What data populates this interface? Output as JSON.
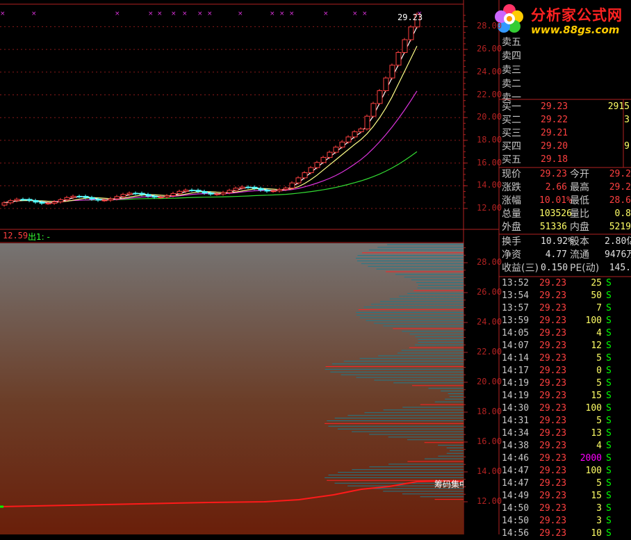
{
  "watermark": {
    "brand": "分析家公式网",
    "url": "www.88gs.com"
  },
  "main_chart": {
    "peak_label": "29.23",
    "y_axis_labels": [
      "28.00",
      "26.00",
      "24.00",
      "22.00",
      "20.00",
      "18.00",
      "16.00",
      "14.00",
      "12.00"
    ]
  },
  "sub_chart": {
    "header_value": "12.59",
    "header_label": "出1: -",
    "annotation": "筹码集中",
    "y_axis_labels": [
      "28.00",
      "26.00",
      "24.00",
      "22.00",
      "20.00",
      "18.00",
      "16.00",
      "14.00",
      "12.00"
    ]
  },
  "quote_panel": {
    "sell_labels": [
      "卖五",
      "卖四",
      "卖三",
      "卖二",
      "卖一"
    ],
    "buy": [
      {
        "label": "买一",
        "price": "29.23",
        "vol": "2915"
      },
      {
        "label": "买二",
        "price": "29.22",
        "vol": "3"
      },
      {
        "label": "买三",
        "price": "29.21",
        "vol": ""
      },
      {
        "label": "买四",
        "price": "29.20",
        "vol": "9"
      },
      {
        "label": "买五",
        "price": "29.18",
        "vol": ""
      }
    ],
    "stats": [
      {
        "l1": "现价",
        "v1": "29.23",
        "l2": "今开",
        "v2": "29.2"
      },
      {
        "l1": "涨跌",
        "v1": "2.66",
        "l2": "最高",
        "v2": "29.2"
      },
      {
        "l1": "涨幅",
        "v1": "10.01%",
        "l2": "最低",
        "v2": "28.6"
      },
      {
        "l1": "总量",
        "v1": "103526",
        "l2": "量比",
        "v2": "0.8"
      },
      {
        "l1": "外盘",
        "v1": "51336",
        "l2": "内盘",
        "v2": "5219"
      }
    ],
    "fundamentals": [
      {
        "l1": "换手",
        "v1": "10.92%",
        "l2": "股本",
        "v2": "2.80亿"
      },
      {
        "l1": "净资",
        "v1": "4.77",
        "l2": "流通",
        "v2": "9476万"
      },
      {
        "l1": "收益(三)",
        "v1": "0.150",
        "l2": "PE(动)",
        "v2": "145."
      }
    ],
    "ticks": [
      {
        "time": "13:52",
        "price": "29.23",
        "vol": "25",
        "dir": "S"
      },
      {
        "time": "13:54",
        "price": "29.23",
        "vol": "50",
        "dir": "S"
      },
      {
        "time": "13:57",
        "price": "29.23",
        "vol": "7",
        "dir": "S"
      },
      {
        "time": "13:59",
        "price": "29.23",
        "vol": "100",
        "dir": "S"
      },
      {
        "time": "14:05",
        "price": "29.23",
        "vol": "4",
        "dir": "S"
      },
      {
        "time": "14:07",
        "price": "29.23",
        "vol": "12",
        "dir": "S"
      },
      {
        "time": "14:14",
        "price": "29.23",
        "vol": "5",
        "dir": "S"
      },
      {
        "time": "14:17",
        "price": "29.23",
        "vol": "0",
        "dir": "S"
      },
      {
        "time": "14:19",
        "price": "29.23",
        "vol": "5",
        "dir": "S"
      },
      {
        "time": "14:19",
        "price": "29.23",
        "vol": "15",
        "dir": "S"
      },
      {
        "time": "14:30",
        "price": "29.23",
        "vol": "100",
        "dir": "S"
      },
      {
        "time": "14:31",
        "price": "29.23",
        "vol": "5",
        "dir": "S"
      },
      {
        "time": "14:34",
        "price": "29.23",
        "vol": "13",
        "dir": "S"
      },
      {
        "time": "14:38",
        "price": "29.23",
        "vol": "4",
        "dir": "S"
      },
      {
        "time": "14:46",
        "price": "29.23",
        "vol": "2000",
        "dir": "S"
      },
      {
        "time": "14:47",
        "price": "29.23",
        "vol": "100",
        "dir": "S"
      },
      {
        "time": "14:47",
        "price": "29.23",
        "vol": "5",
        "dir": "S"
      },
      {
        "time": "14:49",
        "price": "29.23",
        "vol": "15",
        "dir": "S"
      },
      {
        "time": "14:50",
        "price": "29.23",
        "vol": "3",
        "dir": "S"
      },
      {
        "time": "14:50",
        "price": "29.23",
        "vol": "3",
        "dir": "S"
      },
      {
        "time": "14:56",
        "price": "29.23",
        "vol": "10",
        "dir": "S"
      }
    ],
    "colors": {
      "up": "#ff4040",
      "down": "#54ffff",
      "vol_highlight": "#ff00ff",
      "sell": "#00ff00"
    }
  }
}
